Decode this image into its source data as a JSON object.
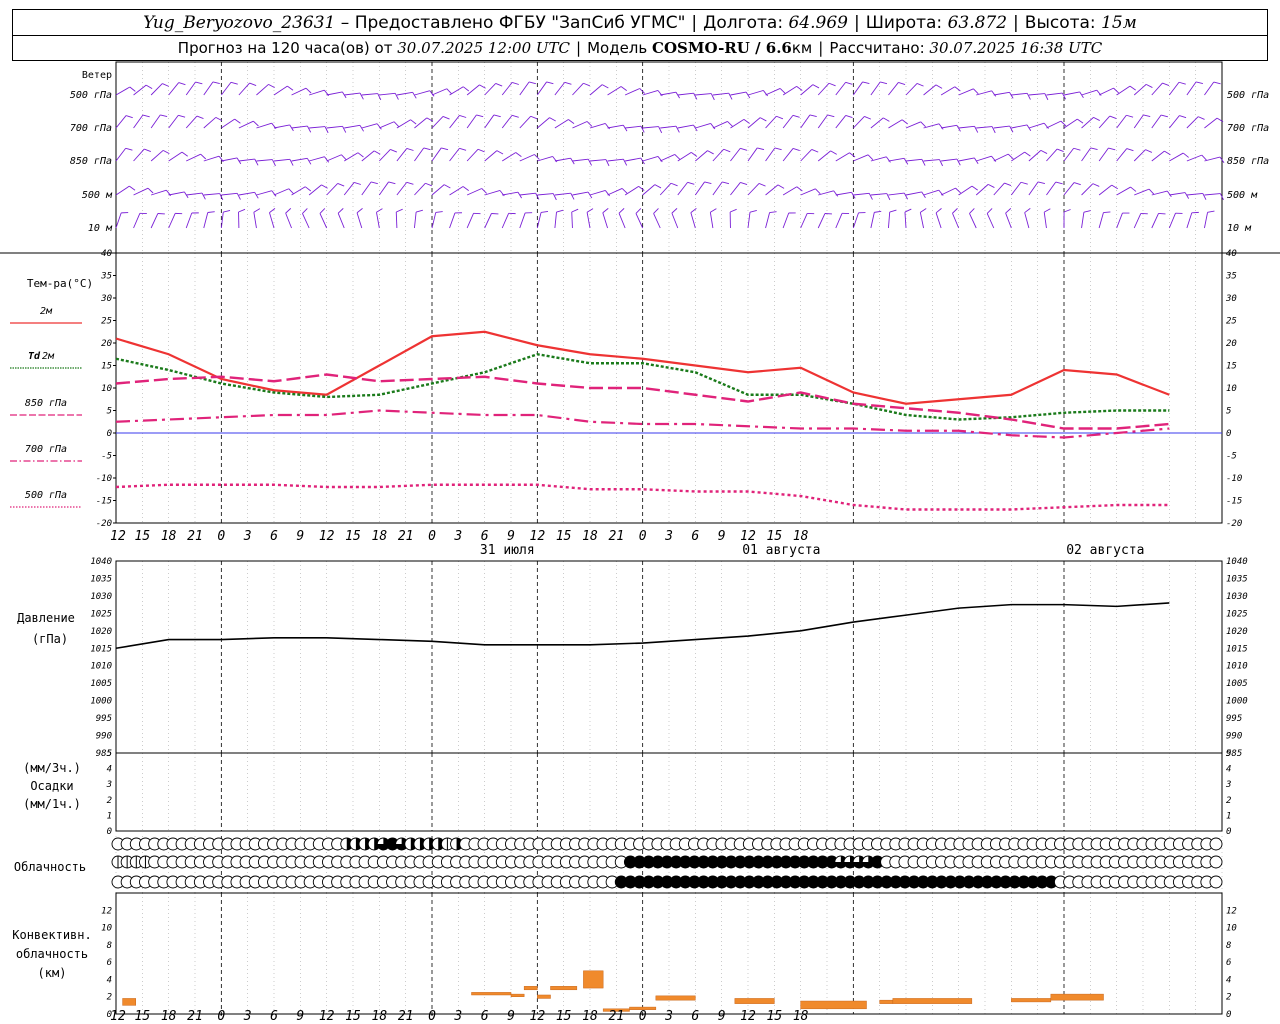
{
  "header": {
    "station": "Yug_Beryozovo_23631",
    "dash": " – ",
    "provider": "Предоставлено ФГБУ \"ЗапСиб УГМС\"",
    "lon_label": "Долгота:",
    "lon_value": "64.969",
    "lat_label": "Широта:",
    "lat_value": "63.872",
    "alt_label": "Высота:",
    "alt_value": "15м",
    "forecast_label": "Прогноз на 120 часа(ов) от",
    "forecast_time": "30.07.2025 12:00 UTC",
    "model_label": "Модель",
    "model_name": "COSMO-RU / 6.6",
    "model_unit": "км",
    "calc_label": "Рассчитано:",
    "calc_time": "30.07.2025 16:38 UTC"
  },
  "time_axis": {
    "hour_labels": [
      "12",
      "15",
      "18",
      "21",
      "0",
      "3",
      "6",
      "9",
      "12",
      "15",
      "18",
      "21",
      "0",
      "3",
      "6",
      "9",
      "12",
      "15",
      "18",
      "21",
      "0",
      "3",
      "6",
      "9",
      "12",
      "15",
      "18"
    ],
    "date_labels": [
      "31 июля",
      "01 августа",
      "02 августа"
    ]
  },
  "wind_panel": {
    "title": "Ветер",
    "levels": [
      "500 гПа",
      "700 гПа",
      "850 гПа",
      "500 м",
      "10  м"
    ],
    "color": "#7a1fd6"
  },
  "legend": {
    "temp_title": "Тем-ра(°С)",
    "items": [
      {
        "label": "2м",
        "prefix": "",
        "color": "#ee3333"
      },
      {
        "label": "2м",
        "prefix": "Td",
        "color": "#1a7a1a"
      },
      {
        "label": "850 гПа",
        "prefix": "",
        "color": "#e0237a"
      },
      {
        "label": "700 гПа",
        "prefix": "",
        "color": "#e0237a"
      },
      {
        "label": "500 гПа",
        "prefix": "",
        "color": "#e0237a"
      }
    ],
    "pressure_title": "Давление",
    "pressure_unit": "(гПа)",
    "precip_unit1": "(мм/3ч.)",
    "precip_title": "Осадки",
    "precip_unit2": "(мм/1ч.)",
    "cloud_title": "Облачность",
    "conv_title1": "Конвективн.",
    "conv_title2": "облачность",
    "conv_unit": "(км)"
  },
  "chart_data": [
    {
      "type": "line",
      "name": "temperature",
      "x": [
        0,
        6,
        12,
        18,
        24,
        30,
        36,
        42,
        48,
        54,
        60,
        66,
        72,
        78,
        84,
        90,
        96,
        102,
        108,
        114,
        120
      ],
      "x_unit": "hours from 30.07.2025 12:00 UTC",
      "ylim": [
        -20,
        40
      ],
      "yticks": [
        -20,
        -15,
        -10,
        -5,
        0,
        5,
        10,
        15,
        20,
        25,
        30,
        35,
        40
      ],
      "series": [
        {
          "name": "2м",
          "values": [
            21,
            17.5,
            12,
            9.5,
            8.5,
            15,
            21.5,
            22.5,
            19.5,
            17.5,
            16.5,
            15,
            13.5,
            14.5,
            9,
            6.5,
            7.5,
            8.5,
            14,
            13,
            8.5
          ]
        },
        {
          "name": "Td 2м",
          "values": [
            16.5,
            14,
            11,
            9,
            8,
            8.5,
            11,
            13.5,
            17.5,
            15.5,
            15.5,
            13.5,
            8.5,
            8.5,
            6.5,
            4,
            3,
            3.5,
            4.5,
            5,
            5
          ]
        },
        {
          "name": "850 гПа",
          "values": [
            11,
            12,
            12.5,
            11.5,
            13,
            11.5,
            12,
            12.5,
            11,
            10,
            10,
            8.5,
            7,
            9,
            6.5,
            5.5,
            4.5,
            3,
            1,
            1,
            2
          ]
        },
        {
          "name": "700 гПа",
          "values": [
            2.5,
            3,
            3.5,
            4,
            4,
            5,
            4.5,
            4,
            4,
            2.5,
            2,
            2,
            1.5,
            1,
            1,
            0.5,
            0.5,
            -0.5,
            -1,
            0,
            1
          ]
        },
        {
          "name": "500 гПа",
          "values": [
            -12,
            -11.5,
            -11.5,
            -11.5,
            -12,
            -12,
            -11.5,
            -11.5,
            -11.5,
            -12.5,
            -12.5,
            -13,
            -13,
            -14,
            -16,
            -17,
            -17,
            -17,
            -16.5,
            -16,
            -16
          ]
        }
      ]
    },
    {
      "type": "line",
      "name": "pressure",
      "x": [
        0,
        6,
        12,
        18,
        24,
        30,
        36,
        42,
        48,
        54,
        60,
        66,
        72,
        78,
        84,
        90,
        96,
        102,
        108,
        114,
        120
      ],
      "ylim": [
        985,
        1040
      ],
      "yticks": [
        985,
        990,
        995,
        1000,
        1005,
        1010,
        1015,
        1020,
        1025,
        1030,
        1035,
        1040
      ],
      "series": [
        {
          "name": "Давление",
          "values": [
            1015,
            1017.5,
            1017.5,
            1018,
            1018,
            1017.5,
            1017,
            1016,
            1016,
            1016,
            1016.5,
            1017.5,
            1018.5,
            1020,
            1022.5,
            1024.5,
            1026.5,
            1027.5,
            1027.5,
            1027,
            1028
          ]
        }
      ]
    },
    {
      "type": "bar",
      "name": "precipitation",
      "ylim": [
        0,
        5
      ],
      "yticks": [
        0,
        1,
        2,
        3,
        4,
        5
      ],
      "values": []
    },
    {
      "type": "table",
      "name": "cloudiness",
      "rows": [
        "0000000000000000000000000222234322221200000000000000000000000000000000000000000000000000000000000000000000000000000000000",
        "1111000000000000000000000000000000000000000000000000000044444444444444444444444333340000000000000000000000000000000000000",
        "0000000000000000000000000000000000000000000000000000000444444444444444444444444444444444444444444444444000000000000000000"
      ],
      "scale": "0=clear,1=quarter,2=half,3=three-quarter,4=overcast"
    },
    {
      "type": "bar",
      "name": "convective_cloudiness",
      "ylim": [
        0,
        14
      ],
      "yticks": [
        0,
        2,
        4,
        6,
        8,
        10,
        12
      ],
      "segments": [
        {
          "t0": 0.5,
          "t1": 1.5,
          "lo": 1.0,
          "hi": 1.8
        },
        {
          "t0": 27,
          "t1": 30,
          "lo": 2.2,
          "hi": 2.5
        },
        {
          "t0": 30,
          "t1": 31,
          "lo": 2.0,
          "hi": 2.3
        },
        {
          "t0": 31,
          "t1": 32,
          "lo": 2.8,
          "hi": 3.2
        },
        {
          "t0": 32,
          "t1": 33,
          "lo": 1.8,
          "hi": 2.2
        },
        {
          "t0": 33,
          "t1": 35,
          "lo": 2.8,
          "hi": 3.2
        },
        {
          "t0": 35.5,
          "t1": 37,
          "lo": 3.0,
          "hi": 5.0
        },
        {
          "t0": 37,
          "t1": 39,
          "lo": 0.3,
          "hi": 0.6
        },
        {
          "t0": 39,
          "t1": 41,
          "lo": 0.5,
          "hi": 0.8
        },
        {
          "t0": 41,
          "t1": 44,
          "lo": 1.6,
          "hi": 2.1
        },
        {
          "t0": 47,
          "t1": 50,
          "lo": 1.2,
          "hi": 1.8
        },
        {
          "t0": 52,
          "t1": 57,
          "lo": 0.6,
          "hi": 1.5
        },
        {
          "t0": 58,
          "t1": 59,
          "lo": 1.2,
          "hi": 1.6
        },
        {
          "t0": 59,
          "t1": 65,
          "lo": 1.2,
          "hi": 1.8
        },
        {
          "t0": 68,
          "t1": 71,
          "lo": 1.4,
          "hi": 1.8
        },
        {
          "t0": 71,
          "t1": 75,
          "lo": 1.6,
          "hi": 2.3
        }
      ]
    }
  ]
}
